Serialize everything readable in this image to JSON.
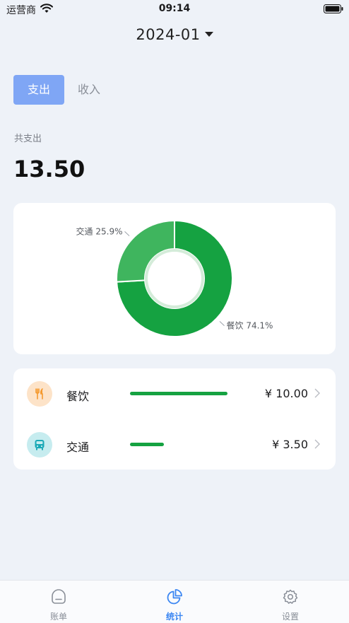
{
  "status_bar": {
    "carrier": "运营商",
    "time": "09:14"
  },
  "header": {
    "month": "2024-01"
  },
  "type_tabs": {
    "expense": "支出",
    "income": "收入",
    "active": "expense"
  },
  "summary": {
    "label": "共支出",
    "amount": "13.50"
  },
  "chart_data": {
    "type": "pie",
    "labels": [
      "餐饮",
      "交通"
    ],
    "values": [
      74.1,
      25.9
    ],
    "value_labels": [
      "餐饮 74.1%",
      "交通 25.9%"
    ],
    "colors": [
      "#15a241",
      "#3fb55e"
    ]
  },
  "categories": [
    {
      "name": "餐饮",
      "amount": "¥ 10.00",
      "share": 0.741,
      "icon": "utensils-icon",
      "icon_bg": "#fde3c8",
      "icon_color": "#f59a2f"
    },
    {
      "name": "交通",
      "amount": "¥ 3.50",
      "share": 0.259,
      "icon": "bus-icon",
      "icon_bg": "#c6ecef",
      "icon_color": "#19a9b6"
    }
  ],
  "bottom_tabs": [
    {
      "label": "账单",
      "icon": "bill-icon"
    },
    {
      "label": "统计",
      "icon": "pie-chart-icon",
      "active": true
    },
    {
      "label": "设置",
      "icon": "settings-icon"
    }
  ]
}
